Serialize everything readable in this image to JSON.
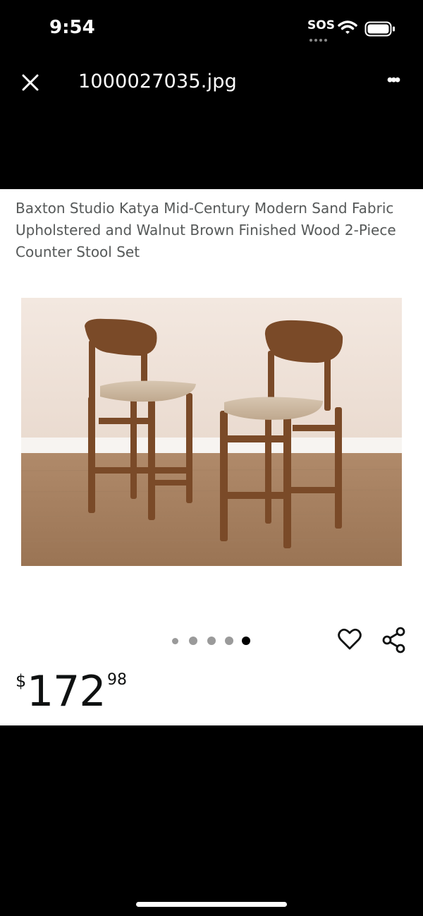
{
  "status_bar": {
    "time": "9:54",
    "sos": "SOS",
    "icons": [
      "wifi-icon",
      "battery-icon"
    ]
  },
  "viewer": {
    "file_name": "1000027035.jpg",
    "close_icon": "close-icon",
    "more_icon": "more-icon",
    "more_glyph": "•••"
  },
  "product": {
    "title": "Baxton Studio Katya Mid-Century Modern Sand Fabric Upholstered and Walnut Brown Finished Wood 2-Piece Counter Stool Set",
    "image_count": 5,
    "active_image": 5,
    "price": {
      "symbol": "$",
      "whole": "172",
      "fraction": "98"
    }
  },
  "colors": {
    "background": "#000000",
    "content_bg": "#ffffff",
    "title_text": "#565959",
    "price_text": "#0f1111",
    "wood": "#7a4a28",
    "fabric": "#c9b49a"
  }
}
